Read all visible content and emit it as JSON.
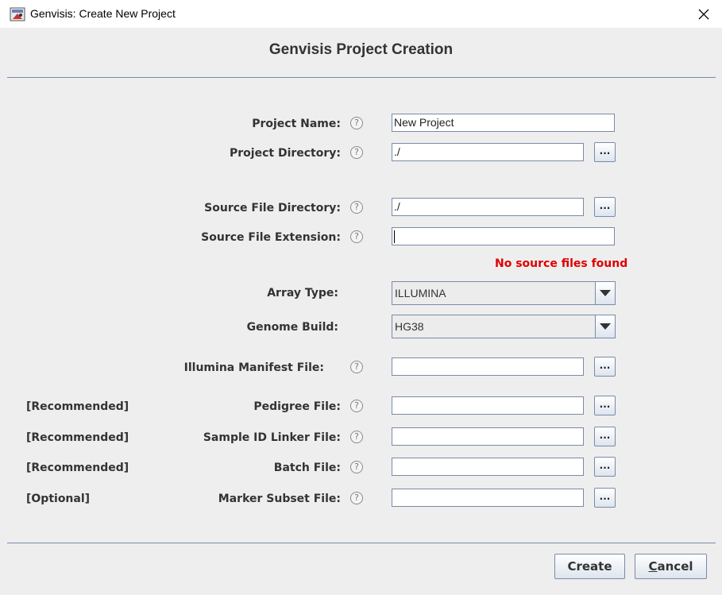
{
  "window": {
    "title": "Genvisis: Create New Project",
    "close_icon": "close-icon"
  },
  "header": {
    "title": "Genvisis Project Creation"
  },
  "form": {
    "project_name": {
      "label": "Project Name:",
      "value": "New Project"
    },
    "project_directory": {
      "label": "Project Directory:",
      "value": "./",
      "browse_label": "..."
    },
    "source_file_directory": {
      "label": "Source File Directory:",
      "value": "./",
      "browse_label": "..."
    },
    "source_file_extension": {
      "label": "Source File Extension:",
      "value": ""
    },
    "error_message": "No source files found",
    "array_type": {
      "label": "Array Type:",
      "value": "ILLUMINA"
    },
    "genome_build": {
      "label": "Genome Build:",
      "value": "HG38"
    },
    "illumina_manifest_file": {
      "label": "Illumina Manifest File:",
      "value": "",
      "browse_label": "..."
    },
    "pedigree_file": {
      "tag": "[Recommended]",
      "label": "Pedigree File:",
      "value": "",
      "browse_label": "..."
    },
    "sample_id_linker_file": {
      "tag": "[Recommended]",
      "label": "Sample ID Linker File:",
      "value": "",
      "browse_label": "..."
    },
    "batch_file": {
      "tag": "[Recommended]",
      "label": "Batch File:",
      "value": "",
      "browse_label": "..."
    },
    "marker_subset_file": {
      "tag": "[Optional]",
      "label": "Marker Subset File:",
      "value": "",
      "browse_label": "..."
    },
    "help_glyph": "?"
  },
  "buttons": {
    "create_label": "Create",
    "cancel_mnemonic": "C",
    "cancel_rest": "ancel"
  },
  "colors": {
    "error": "#e00000",
    "border": "#7a8aa8",
    "background": "#eeeeee"
  }
}
